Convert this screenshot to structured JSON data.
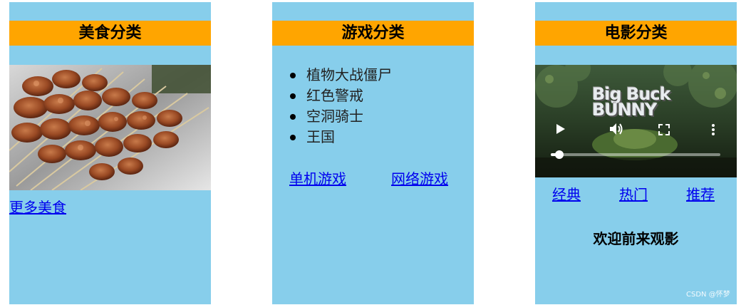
{
  "panels": {
    "food": {
      "title": "美食分类",
      "more_link": "更多美食"
    },
    "games": {
      "title": "游戏分类",
      "items": [
        "植物大战僵尸",
        "红色警戒",
        "空洞骑士",
        "王国"
      ],
      "links": [
        "单机游戏",
        "网络游戏"
      ]
    },
    "movies": {
      "title": "电影分类",
      "video": {
        "title_line1": "Big Buck",
        "title_line2": "BUNNY",
        "progress": 0.05,
        "icons": [
          "play-icon",
          "volume-icon",
          "fullscreen-icon",
          "more-options-icon"
        ]
      },
      "links": [
        "经典",
        "热门",
        "推荐"
      ],
      "welcome": "欢迎前来观影"
    }
  },
  "watermark": "CSDN @怀梦",
  "colors": {
    "panel_bg": "#87ceeb",
    "title_bg": "#ffa500",
    "link": "#0000ee"
  }
}
